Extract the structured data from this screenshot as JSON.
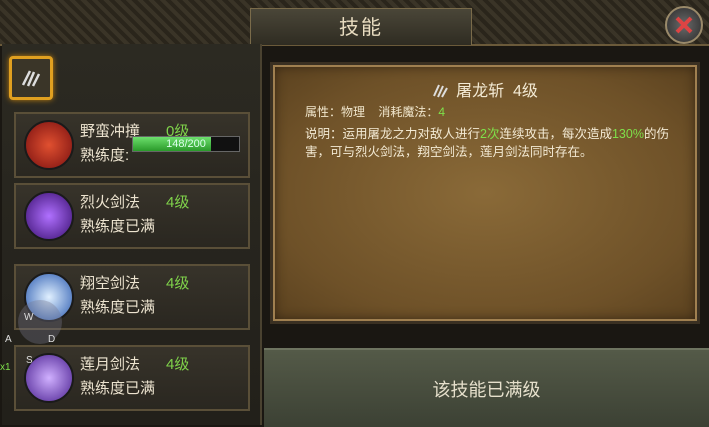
{
  "window": {
    "title": "技能"
  },
  "selected_skill_icon": "sword-claw-icon",
  "skills": [
    {
      "name": "野蛮冲撞",
      "level": "0级",
      "prof_label": "熟练度:",
      "prof_value": "148/200",
      "progress": 0.74,
      "icon": "charge-icon"
    },
    {
      "name": "烈火剑法",
      "level": "4级",
      "prof_label": "熟练度已满",
      "icon": "fire-sword-icon"
    },
    {
      "name": "翔空剑法",
      "level": "4级",
      "prof_label": "熟练度已满",
      "icon": "sky-sword-icon"
    },
    {
      "name": "莲月剑法",
      "level": "4级",
      "prof_label": "熟练度已满",
      "icon": "lotus-moon-icon"
    }
  ],
  "detail": {
    "name": "屠龙斩",
    "level": "4级",
    "attr_label": "属性：物理",
    "mp_label": "消耗魔法：",
    "mp_value": "4",
    "desc_a": "说明：运用屠龙之力对敌人进行",
    "desc_hits": "2次",
    "desc_b": "连续攻击，每次造成",
    "desc_pct": "130%",
    "desc_c": "的伤害，可与烈火剑法，翔空剑法，莲月剑法同时存在。"
  },
  "footer": {
    "status": "该技能已满级"
  },
  "overlay": {
    "w": "W",
    "a": "A",
    "d": "D",
    "s": "S",
    "x": "x1"
  },
  "colors": {
    "accent_green": "#7fe04a",
    "selected_border": "#e0a020"
  }
}
